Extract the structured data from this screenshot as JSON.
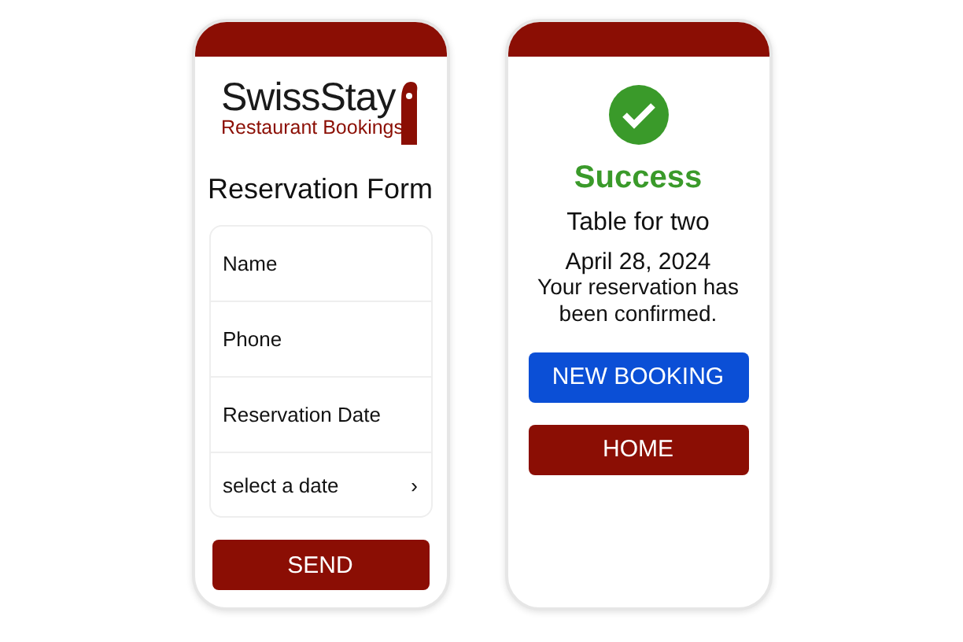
{
  "form_screen": {
    "logo": {
      "name": "SwissStay",
      "subtitle": "Restaurant Bookings"
    },
    "title": "Reservation Form",
    "fields": [
      {
        "kind": "input",
        "placeholder": "Name"
      },
      {
        "kind": "input",
        "placeholder": "Phone"
      },
      {
        "kind": "label",
        "label": "Reservation Date"
      },
      {
        "kind": "picker",
        "value": "select a date",
        "chevron": "›"
      }
    ],
    "submit": "SEND"
  },
  "success_screen": {
    "status": "Success",
    "table": "Table for two",
    "date": "April 28, 2024",
    "message": "Your reservation has been confirmed.",
    "buttons": [
      {
        "label": "NEW BOOKING",
        "kind": "primary"
      },
      {
        "label": "HOME",
        "kind": "secondary"
      }
    ]
  }
}
